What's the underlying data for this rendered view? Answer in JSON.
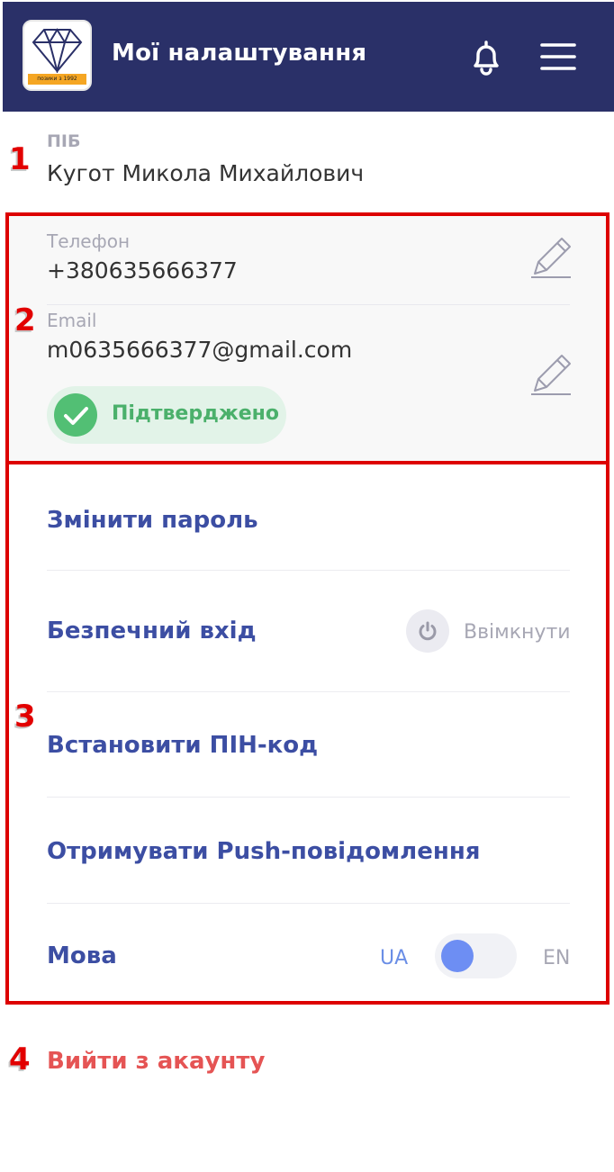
{
  "header": {
    "title": "Мої налаштування",
    "logo_ribbon": "позики з 1992",
    "bell_icon": "bell-icon",
    "menu_icon": "hamburger-menu-icon",
    "background": "#2a3068"
  },
  "annotations": [
    "1",
    "2",
    "3",
    "4"
  ],
  "profile": {
    "pib_label": "ПІБ",
    "pib_value": "Кугот Микола Михайлович"
  },
  "contacts": {
    "phone_label": "Телефон",
    "phone_value": "+380635666377",
    "email_label": "Email",
    "email_value": "m0635666377@gmail.com",
    "verified_label": "Підтверджено",
    "edit_icon": "pencil-icon"
  },
  "settings": {
    "change_password": "Змінити пароль",
    "secure_login": "Безпечний вхід",
    "secure_login_state": "Ввімкнути",
    "set_pin": "Встановити ПІН-код",
    "push_notifications": "Отримувати Push-повідомлення",
    "language": "Мова",
    "lang_left": "UA",
    "lang_right": "EN"
  },
  "logout": "Вийти з акаунту",
  "colors": {
    "accent": "#3c4ea3",
    "verified": "#52bf74",
    "danger": "#e55454",
    "marker": "#e20000"
  }
}
